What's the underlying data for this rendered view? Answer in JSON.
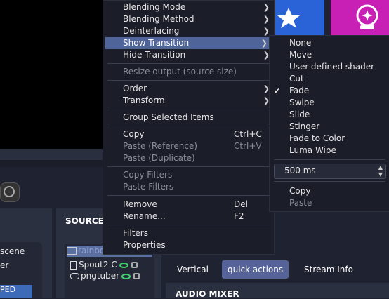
{
  "background": {
    "scenes": [
      "scene",
      "er"
    ],
    "scene_badge": "PED",
    "sources_title": "SOURCES",
    "sources": [
      {
        "name": "rainbow",
        "selected": true
      },
      {
        "name": "Spout2 C"
      },
      {
        "name": "pngtuber"
      }
    ],
    "tabs": [
      "Vertical",
      "quick actions",
      "Stream Info"
    ],
    "active_tab": "quick actions",
    "audio_mixer_title": "AUDIO MIXER",
    "tile_colors": {
      "blue": "#2a63d8",
      "pink": "#c81fb4"
    },
    "tile_icons": [
      "star-icon",
      "sparkle-target-icon"
    ]
  },
  "context_menu": {
    "items": [
      {
        "label": "Blending Mode",
        "submenu": true
      },
      {
        "label": "Blending Method",
        "submenu": true
      },
      {
        "label": "Deinterlacing",
        "submenu": true
      },
      {
        "label": "Show Transition",
        "submenu": true,
        "highlighted": true
      },
      {
        "label": "Hide Transition",
        "submenu": true
      },
      {
        "label": "Resize output (source size)",
        "disabled": true
      },
      {
        "label": "Order",
        "submenu": true
      },
      {
        "label": "Transform",
        "submenu": true
      },
      {
        "label": "Group Selected Items"
      },
      {
        "label": "Copy",
        "shortcut": "Ctrl+C"
      },
      {
        "label": "Paste (Reference)",
        "shortcut": "Ctrl+V",
        "disabled": true
      },
      {
        "label": "Paste (Duplicate)",
        "disabled": true
      },
      {
        "label": "Copy Filters",
        "disabled": true
      },
      {
        "label": "Paste Filters",
        "disabled": true
      },
      {
        "label": "Remove",
        "shortcut": "Del"
      },
      {
        "label": "Rename...",
        "shortcut": "F2"
      },
      {
        "label": "Filters"
      },
      {
        "label": "Properties"
      }
    ]
  },
  "transition_submenu": {
    "items": [
      "None",
      "Move",
      "User-defined shader",
      "Cut",
      "Fade",
      "Swipe",
      "Slide",
      "Stinger",
      "Fade to Color",
      "Luma Wipe"
    ],
    "checked": "Fade",
    "duration": "500 ms",
    "copy": "Copy",
    "paste": "Paste"
  },
  "colors": {
    "highlight": "#4f6499",
    "menu_bg": "#1b1d29",
    "accent_tab": "#556399"
  }
}
